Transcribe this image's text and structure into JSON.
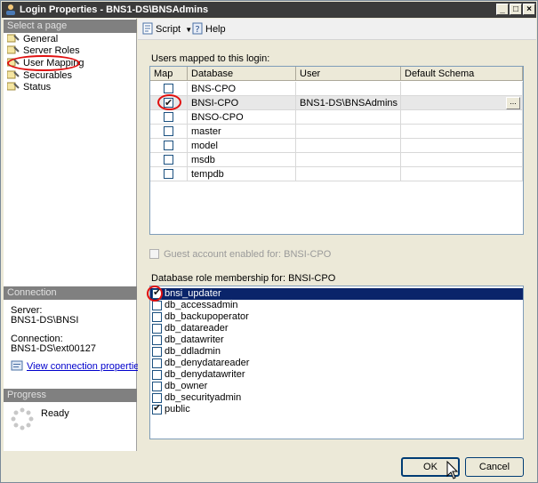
{
  "window": {
    "title": "Login Properties - BNS1-DS\\BNSAdmins"
  },
  "left": {
    "select_page_header": "Select a page",
    "pages": [
      {
        "label": "General"
      },
      {
        "label": "Server Roles"
      },
      {
        "label": "User Mapping"
      },
      {
        "label": "Securables"
      },
      {
        "label": "Status"
      }
    ],
    "connection_header": "Connection",
    "server_label": "Server:",
    "server_value": "BNS1-DS\\BNSI",
    "connection_label": "Connection:",
    "connection_value": "BNS1-DS\\ext00127",
    "view_props_link": "View connection properties",
    "progress_header": "Progress",
    "progress_status": "Ready"
  },
  "toolbar": {
    "script_label": "Script",
    "help_label": "Help"
  },
  "users_mapped": {
    "label": "Users mapped to this login:",
    "columns": [
      "Map",
      "Database",
      "User",
      "Default Schema"
    ],
    "rows": [
      {
        "checked": false,
        "database": "BNS-CPO",
        "user": "",
        "schema": ""
      },
      {
        "checked": true,
        "database": "BNSI-CPO",
        "user": "BNS1-DS\\BNSAdmins",
        "schema": ""
      },
      {
        "checked": false,
        "database": "BNSO-CPO",
        "user": "",
        "schema": ""
      },
      {
        "checked": false,
        "database": "master",
        "user": "",
        "schema": ""
      },
      {
        "checked": false,
        "database": "model",
        "user": "",
        "schema": ""
      },
      {
        "checked": false,
        "database": "msdb",
        "user": "",
        "schema": ""
      },
      {
        "checked": false,
        "database": "tempdb",
        "user": "",
        "schema": ""
      }
    ],
    "ellipsis": "..."
  },
  "guest": {
    "label": "Guest account enabled for: BNSI-CPO"
  },
  "roles": {
    "label": "Database role membership for: BNSI-CPO",
    "items": [
      {
        "name": "bnsi_updater",
        "checked": true,
        "selected": true
      },
      {
        "name": "db_accessadmin",
        "checked": false,
        "selected": false
      },
      {
        "name": "db_backupoperator",
        "checked": false,
        "selected": false
      },
      {
        "name": "db_datareader",
        "checked": false,
        "selected": false
      },
      {
        "name": "db_datawriter",
        "checked": false,
        "selected": false
      },
      {
        "name": "db_ddladmin",
        "checked": false,
        "selected": false
      },
      {
        "name": "db_denydatareader",
        "checked": false,
        "selected": false
      },
      {
        "name": "db_denydatawriter",
        "checked": false,
        "selected": false
      },
      {
        "name": "db_owner",
        "checked": false,
        "selected": false
      },
      {
        "name": "db_securityadmin",
        "checked": false,
        "selected": false
      },
      {
        "name": "public",
        "checked": true,
        "selected": false
      }
    ]
  },
  "buttons": {
    "ok": "OK",
    "cancel": "Cancel"
  },
  "colors": {
    "titlebar": "#3b3b3b",
    "selection": "#0a246a",
    "annotation": "#e01010"
  }
}
